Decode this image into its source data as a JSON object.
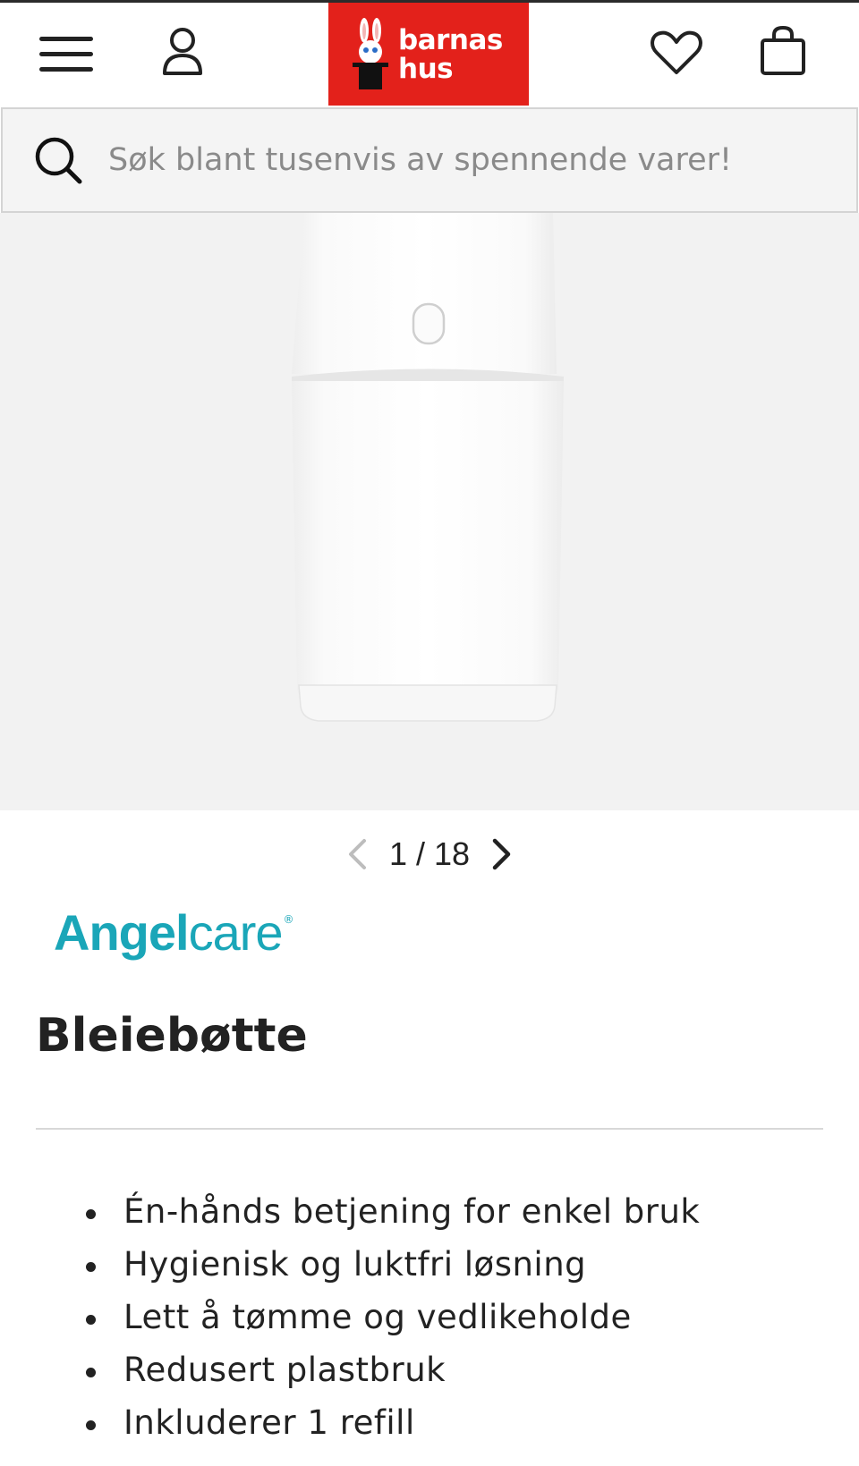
{
  "header": {
    "logo_line1": "barnas",
    "logo_line2": "hus",
    "menu_icon": "hamburger-menu-icon",
    "account_icon": "user-icon",
    "wishlist_icon": "heart-icon",
    "cart_icon": "shopping-bag-icon",
    "brand_color": "#e3211b"
  },
  "search": {
    "placeholder": "Søk blant tusenvis av spennende varer!"
  },
  "gallery": {
    "pager_text": "1 / 18"
  },
  "product": {
    "brand_part1": "Angel",
    "brand_part2": "care",
    "brand_reg": "®",
    "title": "Bleiebøtte",
    "features": [
      "Én-hånds betjening for enkel bruk",
      "Hygienisk og luktfri løsning",
      "Lett å tømme og vedlikeholde",
      "Redusert plastbruk",
      "Inkluderer 1 refill"
    ]
  }
}
